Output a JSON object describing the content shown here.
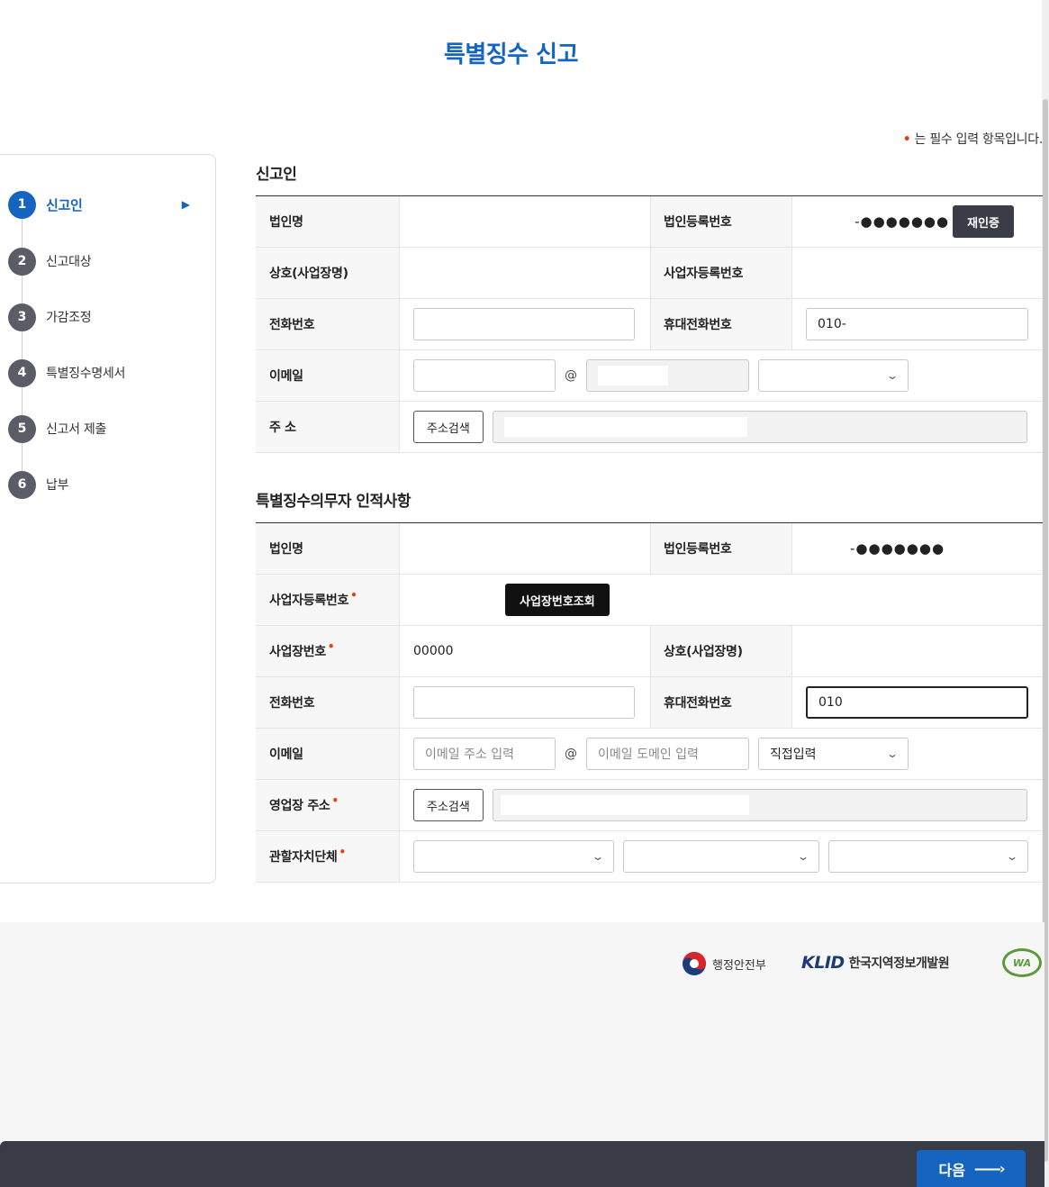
{
  "page": {
    "title": "특별징수 신고",
    "required_note": "는 필수 입력 항목입니다.",
    "required_mark": "•"
  },
  "steps": [
    {
      "num": "1",
      "label": "신고인"
    },
    {
      "num": "2",
      "label": "신고대상"
    },
    {
      "num": "3",
      "label": "가감조정"
    },
    {
      "num": "4",
      "label": "특별징수명세서"
    },
    {
      "num": "5",
      "label": "신고서 제출"
    },
    {
      "num": "6",
      "label": "납부"
    }
  ],
  "reporter": {
    "section_title": "신고인",
    "corp_name_label": "법인명",
    "corp_reg_label": "법인등록번호",
    "corp_reg_value": "-●●●●●●●",
    "reauth_button": "재인증",
    "trade_name_label": "상호(사업장명)",
    "biz_reg_label": "사업자등록번호",
    "phone_label": "전화번호",
    "mobile_label": "휴대전화번호",
    "mobile_value": "010-",
    "email_label": "이메일",
    "at": "@",
    "address_label": "주 소",
    "address_search_button": "주소검색"
  },
  "agent": {
    "section_title": "특별징수의무자 인적사항",
    "corp_name_label": "법인명",
    "corp_reg_label": "법인등록번호",
    "corp_reg_value": "-●●●●●●●",
    "biz_reg_label": "사업자등록번호",
    "biz_lookup_button": "사업장번호조회",
    "site_no_label": "사업장번호",
    "site_no_value": "00000",
    "trade_name_label": "상호(사업장명)",
    "phone_label": "전화번호",
    "mobile_label": "휴대전화번호",
    "mobile_value": "010",
    "email_label": "이메일",
    "email_placeholder": "이메일 주소 입력",
    "at": "@",
    "domain_placeholder": "이메일 도메인 입력",
    "domain_select": "직접입력",
    "address_label": "영업장 주소",
    "address_search_button": "주소검색",
    "jurisdiction_label": "관할자치단체"
  },
  "footer": {
    "mois": "행정안전부",
    "klid_mark": "KLID",
    "klid_text": "한국지역정보개발원",
    "wa_mark": "WA"
  },
  "next_button": "다음"
}
